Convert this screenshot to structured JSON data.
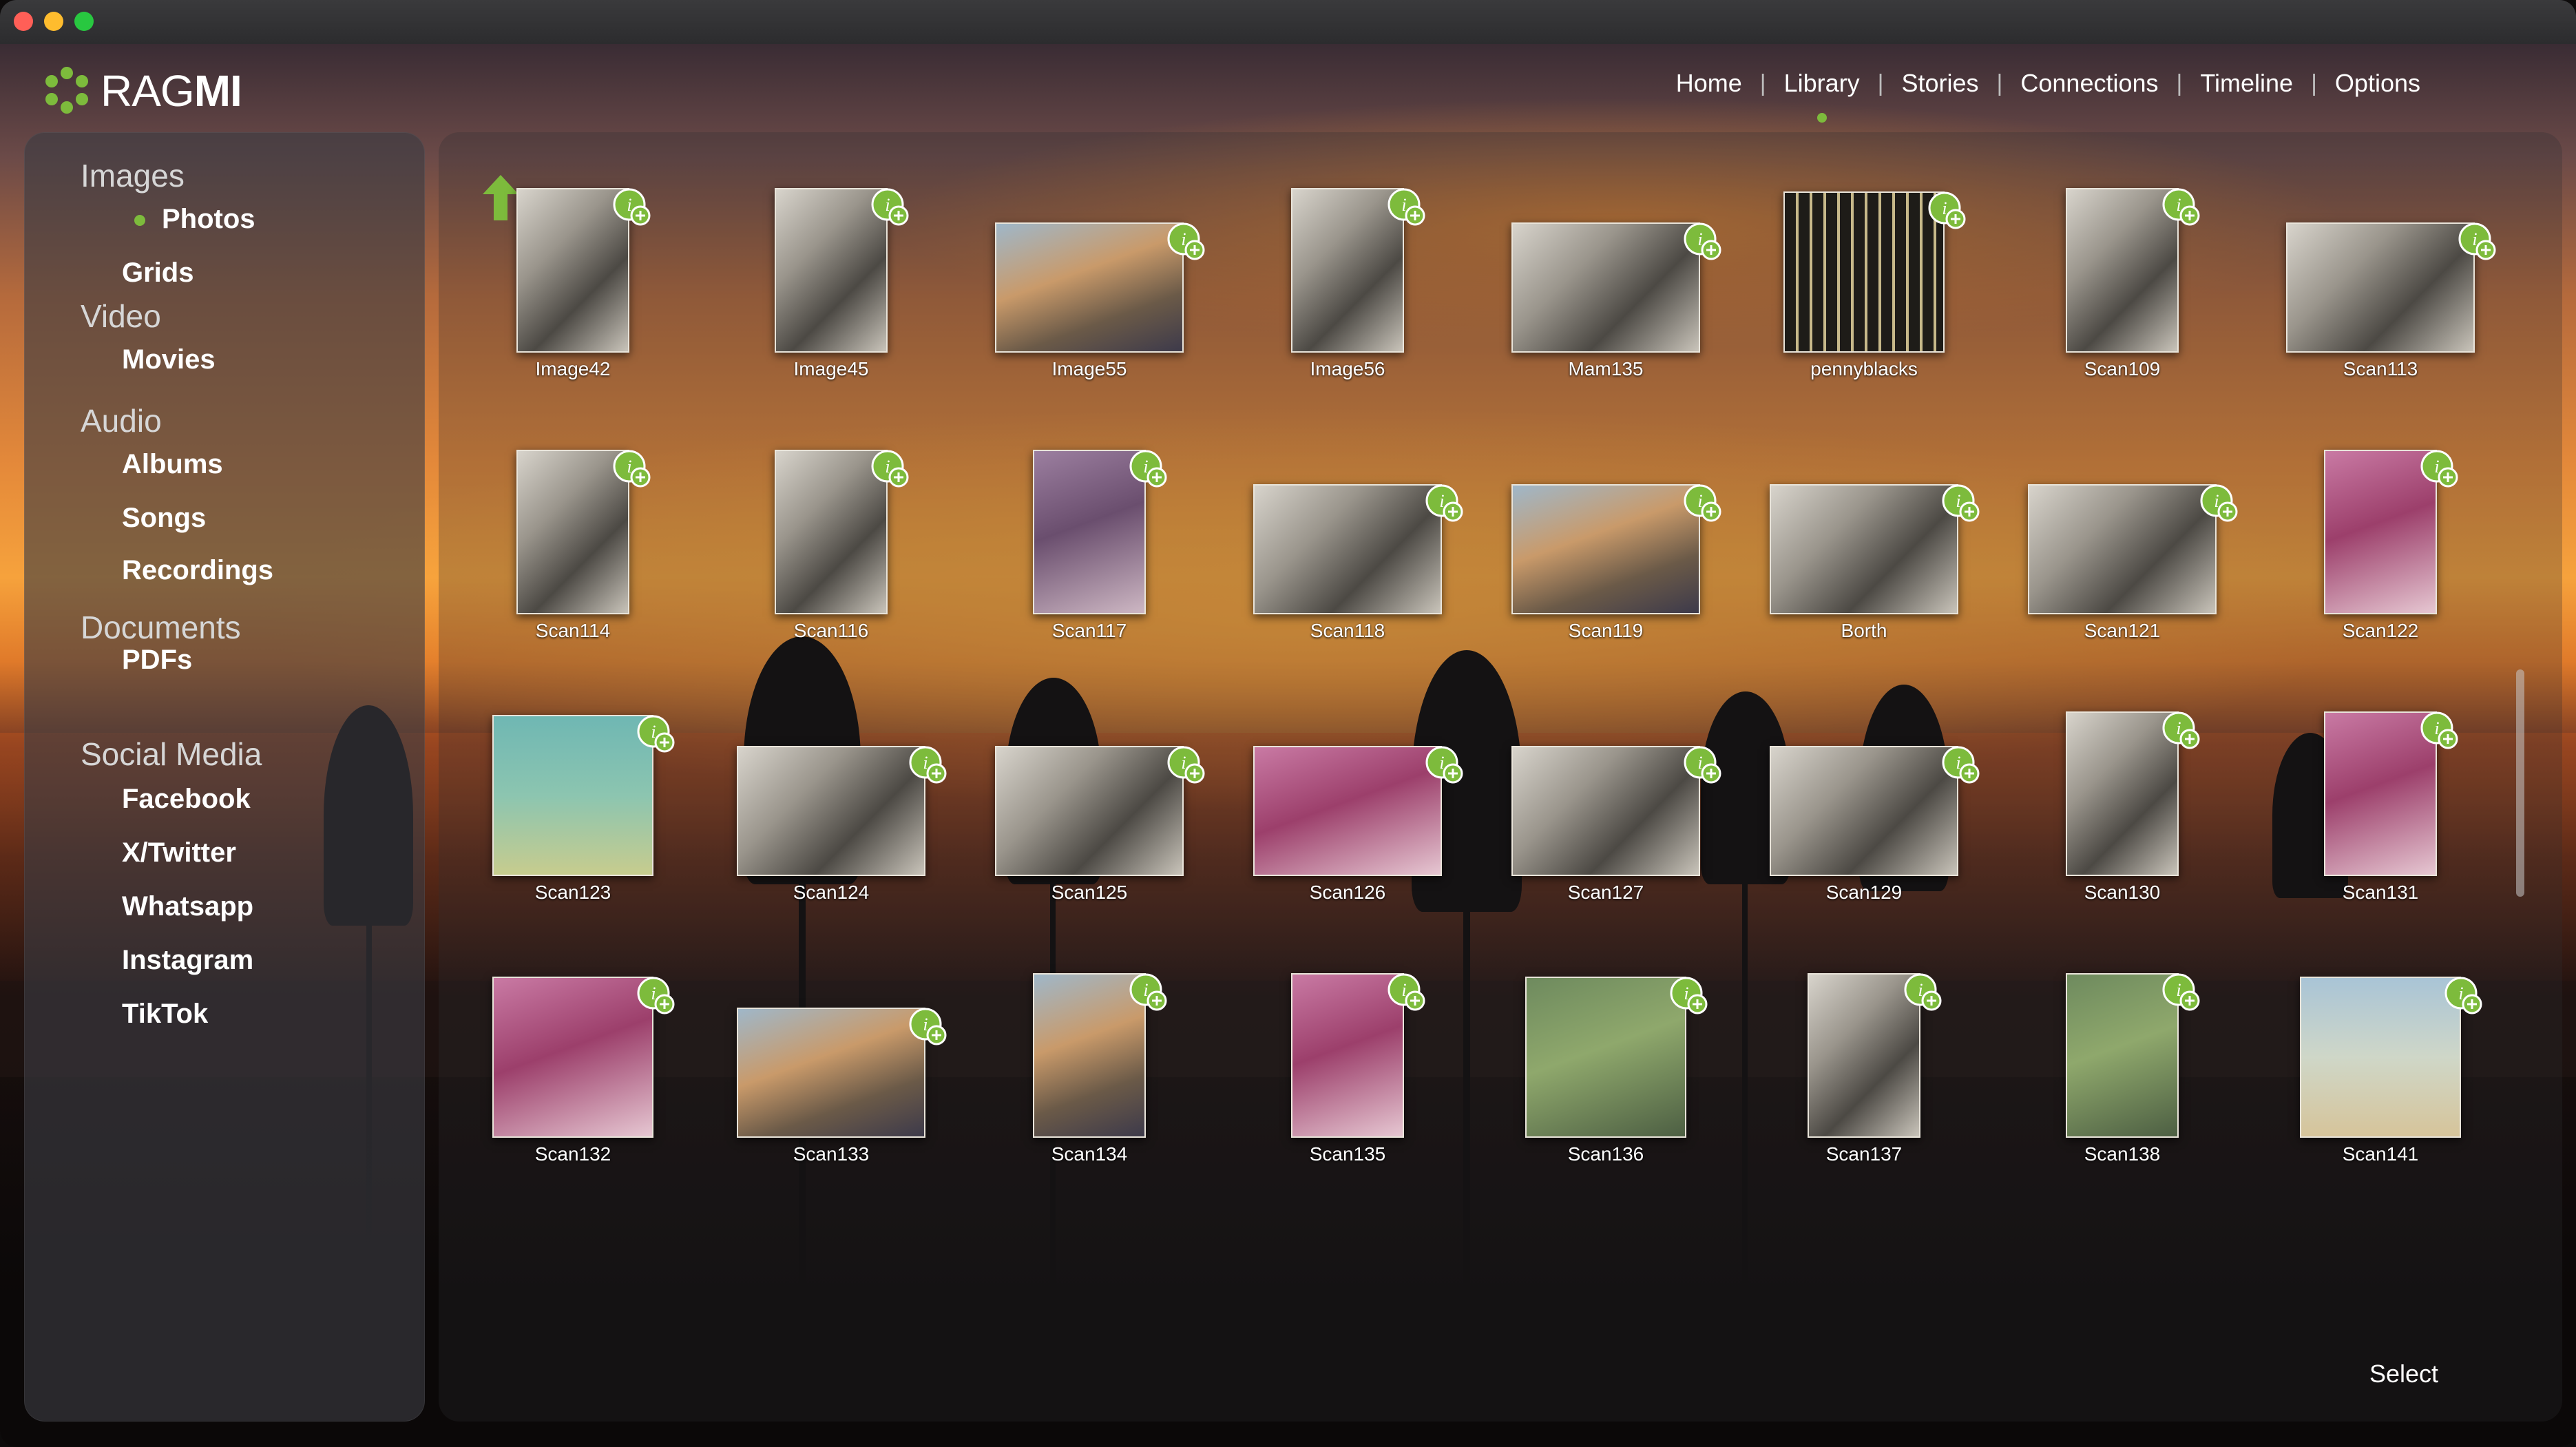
{
  "window": {
    "traffic_lights": [
      {
        "name": "close",
        "color": "#ff5f57"
      },
      {
        "name": "minimize",
        "color": "#febc2e"
      },
      {
        "name": "zoom",
        "color": "#28c840"
      }
    ]
  },
  "app": {
    "logo_light": "RAG",
    "logo_bold": "MI",
    "accent_color": "#7dbb3c"
  },
  "topnav": {
    "items": [
      {
        "label": "Home",
        "active": false
      },
      {
        "label": "Library",
        "active": true
      },
      {
        "label": "Stories",
        "active": false
      },
      {
        "label": "Connections",
        "active": false
      },
      {
        "label": "Timeline",
        "active": false
      },
      {
        "label": "Options",
        "active": false
      }
    ],
    "separator": "|"
  },
  "sidebar": {
    "sections": [
      {
        "label": "Images",
        "items": [
          {
            "label": "Photos",
            "active": true
          },
          {
            "label": "Grids",
            "active": false
          }
        ]
      },
      {
        "label": "Video",
        "items": [
          {
            "label": "Movies",
            "active": false
          }
        ]
      },
      {
        "label": "Audio",
        "items": [
          {
            "label": "Albums",
            "active": false
          },
          {
            "label": "Songs",
            "active": false
          },
          {
            "label": "Recordings",
            "active": false
          }
        ]
      },
      {
        "label": "Documents",
        "items": [
          {
            "label": "PDFs",
            "active": false
          }
        ]
      },
      {
        "label": "Social Media",
        "items": [
          {
            "label": "Facebook",
            "active": false
          },
          {
            "label": "X/Twitter",
            "active": false
          },
          {
            "label": "Whatsapp",
            "active": false
          },
          {
            "label": "Instagram",
            "active": false
          },
          {
            "label": "TikTok",
            "active": false
          }
        ]
      }
    ]
  },
  "main": {
    "up_icon": "up-arrow-icon",
    "badge_icon": "info-add-badge-icon",
    "select_label": "Select",
    "photos": [
      {
        "name": "Image42",
        "tone": "bw",
        "shape": "portrait"
      },
      {
        "name": "Image45",
        "tone": "bw",
        "shape": "portrait"
      },
      {
        "name": "Image55",
        "tone": "color",
        "shape": "landscape"
      },
      {
        "name": "Image56",
        "tone": "bw",
        "shape": "portrait"
      },
      {
        "name": "Mam135",
        "tone": "bw",
        "shape": "landscape"
      },
      {
        "name": "pennyblacks",
        "tone": "stamp",
        "shape": "square"
      },
      {
        "name": "Scan109",
        "tone": "bw",
        "shape": "portrait"
      },
      {
        "name": "Scan113",
        "tone": "bw",
        "shape": "landscape"
      },
      {
        "name": "Scan114",
        "tone": "bw",
        "shape": "portrait"
      },
      {
        "name": "Scan116",
        "tone": "bw",
        "shape": "portrait"
      },
      {
        "name": "Scan117",
        "tone": "purple",
        "shape": "portrait"
      },
      {
        "name": "Scan118",
        "tone": "bw",
        "shape": "landscape"
      },
      {
        "name": "Scan119",
        "tone": "color",
        "shape": "landscape"
      },
      {
        "name": "Borth",
        "tone": "bw",
        "shape": "landscape"
      },
      {
        "name": "Scan121",
        "tone": "bw",
        "shape": "landscape"
      },
      {
        "name": "Scan122",
        "tone": "magenta",
        "shape": "portrait"
      },
      {
        "name": "Scan123",
        "tone": "teal",
        "shape": "square"
      },
      {
        "name": "Scan124",
        "tone": "bw",
        "shape": "landscape"
      },
      {
        "name": "Scan125",
        "tone": "bw",
        "shape": "landscape"
      },
      {
        "name": "Scan126",
        "tone": "magenta",
        "shape": "landscape"
      },
      {
        "name": "Scan127",
        "tone": "bw",
        "shape": "landscape"
      },
      {
        "name": "Scan129",
        "tone": "bw",
        "shape": "landscape"
      },
      {
        "name": "Scan130",
        "tone": "bw",
        "shape": "portrait"
      },
      {
        "name": "Scan131",
        "tone": "magenta",
        "shape": "portrait"
      },
      {
        "name": "Scan132",
        "tone": "magenta",
        "shape": "square"
      },
      {
        "name": "Scan133",
        "tone": "color",
        "shape": "landscape"
      },
      {
        "name": "Scan134",
        "tone": "color",
        "shape": "portrait"
      },
      {
        "name": "Scan135",
        "tone": "magenta",
        "shape": "portrait"
      },
      {
        "name": "Scan136",
        "tone": "green",
        "shape": "square"
      },
      {
        "name": "Scan137",
        "tone": "bw",
        "shape": "portrait"
      },
      {
        "name": "Scan138",
        "tone": "green",
        "shape": "portrait"
      },
      {
        "name": "Scan141",
        "tone": "beach",
        "shape": "square"
      },
      {
        "name": "",
        "tone": "bw",
        "shape": "partial"
      },
      {
        "name": "",
        "tone": "green",
        "shape": "partial"
      },
      {
        "name": "",
        "tone": "magenta",
        "shape": "partial"
      },
      {
        "name": "",
        "tone": "teal",
        "shape": "partial"
      },
      {
        "name": "",
        "tone": "bw",
        "shape": "partial"
      },
      {
        "name": "",
        "tone": "green",
        "shape": "partial"
      },
      {
        "name": "",
        "tone": "bw",
        "shape": "partial"
      },
      {
        "name": "",
        "tone": "purple",
        "shape": "partial"
      }
    ]
  }
}
